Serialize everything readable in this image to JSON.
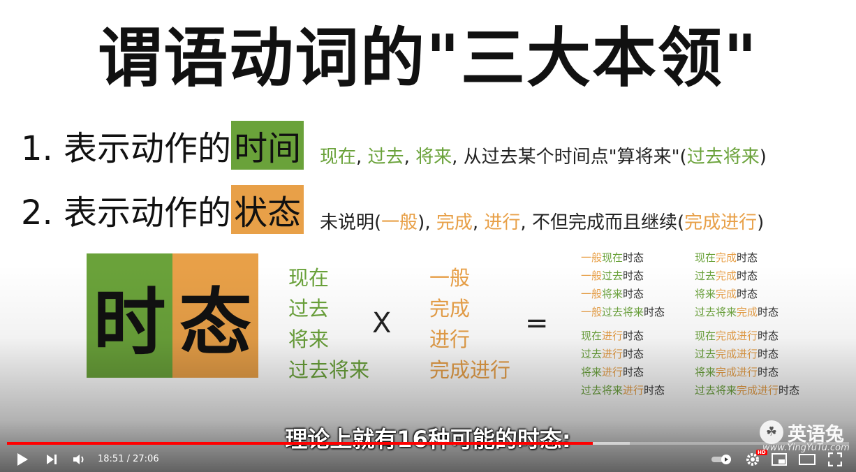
{
  "slide": {
    "title": "谓语动词的\"三大本领\"",
    "line1": {
      "prefix": "1. 表示动作的",
      "highlight": "时间"
    },
    "line2": {
      "prefix": "2. 表示动作的",
      "highlight": "状态"
    },
    "desc1": [
      {
        "text": "现在",
        "color": "green"
      },
      {
        "text": ", ",
        "color": "plain"
      },
      {
        "text": "过去",
        "color": "green"
      },
      {
        "text": ", ",
        "color": "plain"
      },
      {
        "text": "将来",
        "color": "green"
      },
      {
        "text": ", 从过去某个时间点\"算将来\"(",
        "color": "plain"
      },
      {
        "text": "过去将来",
        "color": "green"
      },
      {
        "text": ")",
        "color": "plain"
      }
    ],
    "desc2": [
      {
        "text": "未说明(",
        "color": "plain"
      },
      {
        "text": "一般",
        "color": "orange"
      },
      {
        "text": "), ",
        "color": "plain"
      },
      {
        "text": "完成",
        "color": "orange"
      },
      {
        "text": ", ",
        "color": "plain"
      },
      {
        "text": "进行",
        "color": "orange"
      },
      {
        "text": ", 不但完成而且继续(",
        "color": "plain"
      },
      {
        "text": "完成进行",
        "color": "orange"
      },
      {
        "text": ")",
        "color": "plain"
      }
    ],
    "box_left": "时",
    "box_right": "态",
    "times": [
      "现在",
      "过去",
      "将来",
      "过去将来"
    ],
    "states": [
      "一般",
      "完成",
      "进行",
      "完成进行"
    ],
    "op_times": "X",
    "op_equals": "=",
    "suffix": "时态",
    "tenses_col1": [
      [
        {
          "t": "一般",
          "c": "orange"
        },
        {
          "t": "现在",
          "c": "green"
        },
        {
          "t": "时态",
          "c": "plain"
        }
      ],
      [
        {
          "t": "一般",
          "c": "orange"
        },
        {
          "t": "过去",
          "c": "green"
        },
        {
          "t": "时态",
          "c": "plain"
        }
      ],
      [
        {
          "t": "一般",
          "c": "orange"
        },
        {
          "t": "将来",
          "c": "green"
        },
        {
          "t": "时态",
          "c": "plain"
        }
      ],
      [
        {
          "t": "一般",
          "c": "orange"
        },
        {
          "t": "过去将来",
          "c": "green"
        },
        {
          "t": "时态",
          "c": "plain"
        }
      ]
    ],
    "tenses_col2": [
      [
        {
          "t": "现在",
          "c": "green"
        },
        {
          "t": "完成",
          "c": "orange"
        },
        {
          "t": "时态",
          "c": "plain"
        }
      ],
      [
        {
          "t": "过去",
          "c": "green"
        },
        {
          "t": "完成",
          "c": "orange"
        },
        {
          "t": "时态",
          "c": "plain"
        }
      ],
      [
        {
          "t": "将来",
          "c": "green"
        },
        {
          "t": "完成",
          "c": "orange"
        },
        {
          "t": "时态",
          "c": "plain"
        }
      ],
      [
        {
          "t": "过去将来",
          "c": "green"
        },
        {
          "t": "完成",
          "c": "orange"
        },
        {
          "t": "时态",
          "c": "plain"
        }
      ]
    ],
    "tenses_col3": [
      [
        {
          "t": "现在",
          "c": "green"
        },
        {
          "t": "进行",
          "c": "orange"
        },
        {
          "t": "时态",
          "c": "plain"
        }
      ],
      [
        {
          "t": "过去",
          "c": "green"
        },
        {
          "t": "进行",
          "c": "orange"
        },
        {
          "t": "时态",
          "c": "plain"
        }
      ],
      [
        {
          "t": "将来",
          "c": "green"
        },
        {
          "t": "进行",
          "c": "orange"
        },
        {
          "t": "时态",
          "c": "plain"
        }
      ],
      [
        {
          "t": "过去将来",
          "c": "green"
        },
        {
          "t": "进行",
          "c": "orange"
        },
        {
          "t": "时态",
          "c": "plain"
        }
      ]
    ],
    "tenses_col4": [
      [
        {
          "t": "现在",
          "c": "green"
        },
        {
          "t": "完成进行",
          "c": "orange"
        },
        {
          "t": "时态",
          "c": "plain"
        }
      ],
      [
        {
          "t": "过去",
          "c": "green"
        },
        {
          "t": "完成进行",
          "c": "orange"
        },
        {
          "t": "时态",
          "c": "plain"
        }
      ],
      [
        {
          "t": "将来",
          "c": "green"
        },
        {
          "t": "完成进行",
          "c": "orange"
        },
        {
          "t": "时态",
          "c": "plain"
        }
      ],
      [
        {
          "t": "过去将来",
          "c": "green"
        },
        {
          "t": "完成进行",
          "c": "orange"
        },
        {
          "t": "时态",
          "c": "plain"
        }
      ]
    ]
  },
  "subtitle": "理论上就有16种可能的时态:",
  "watermark": {
    "name": "英语兔",
    "url": "www.YingYuTu.com"
  },
  "player": {
    "current_time": "18:51",
    "separator": " / ",
    "duration": "27:06",
    "progress_fraction": 0.6957,
    "buffered_fraction": 0.74,
    "hd_badge": "HD",
    "icons": [
      "play-icon",
      "next-icon",
      "volume-icon",
      "autoplay-toggle-icon",
      "settings-gear-icon",
      "miniplayer-icon",
      "theater-mode-icon",
      "fullscreen-icon"
    ]
  },
  "colors": {
    "green": "#6aa23a",
    "orange": "#e8a048",
    "progress": "#ff0000"
  }
}
